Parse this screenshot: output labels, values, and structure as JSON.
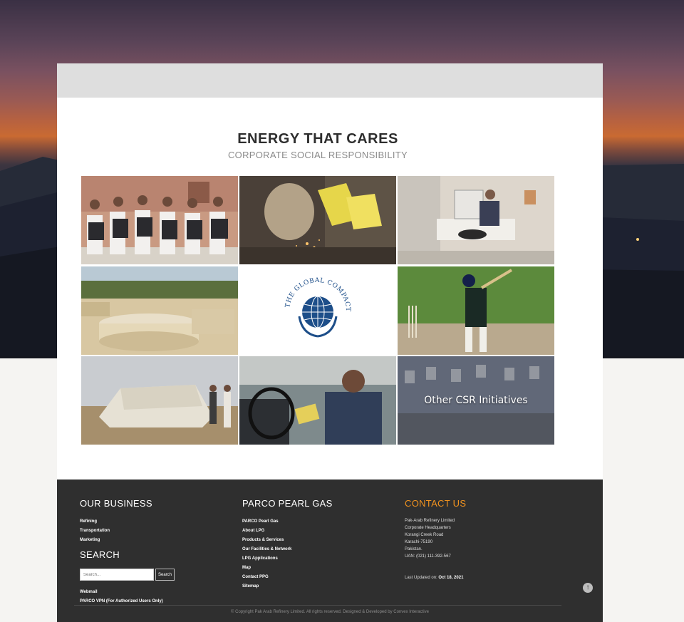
{
  "section": {
    "title": "ENERGY THAT CARES",
    "subtitle": "CORPORATE SOCIAL RESPONSIBILITY"
  },
  "tiles": {
    "other_csr_label": "Other CSR Initiatives",
    "global_compact_text": "THE GLOBAL COMPACT"
  },
  "footer": {
    "business": {
      "heading": "OUR BUSINESS",
      "links": [
        "Refining",
        "Transportation",
        "Marketing"
      ]
    },
    "search": {
      "heading": "SEARCH",
      "placeholder": "Search...",
      "button": "Search"
    },
    "extra_links": [
      "Webmail",
      "PARCO VPN (For Authorized Users Only)"
    ],
    "pearl_gas": {
      "heading": "PARCO PEARL GAS",
      "links": [
        "PARCO Pearl Gas",
        "About LPG",
        "Products & Services",
        "Our Facilities & Network",
        "LPG Applications",
        "Map",
        "Contact PPG",
        "Sitemap"
      ]
    },
    "contact": {
      "heading": "CONTACT US",
      "lines": [
        "Pak-Arab Refinery Limited",
        "Corporate Headquarters",
        "Korangi Creek Road",
        "Karachi-75190",
        "Pakistan.",
        "UAN: (021) 111-392-567"
      ],
      "updated_label": "Last Updated on:",
      "updated_value": "Oct 18, 2021"
    },
    "copyright": "© Copyright Pak Arab Refinery Limited. All rights reserved.      Designed & Developed by Convex Interactive"
  },
  "colors": {
    "accent_orange": "#f0921f",
    "footer_bg": "#2f2f2f"
  },
  "icons": {
    "scroll_top": "arrow-up-circle-icon"
  }
}
